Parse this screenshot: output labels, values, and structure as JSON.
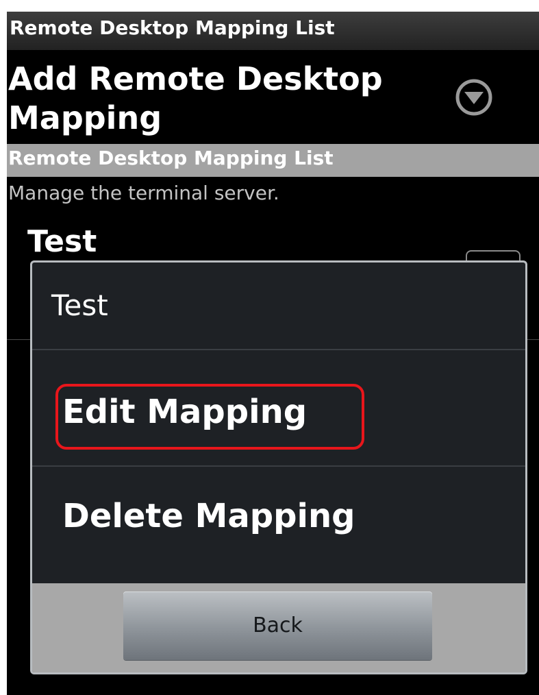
{
  "titlebar": {
    "title": "Remote Desktop Mapping List"
  },
  "add_mapping": {
    "title": "Add Remote Desktop Mapping",
    "icon": "dropdown-arrow-icon"
  },
  "section": {
    "header": "Remote Desktop Mapping List",
    "summary": "Manage the terminal server."
  },
  "list": {
    "items": [
      {
        "title": "Test"
      }
    ]
  },
  "dialog": {
    "title": "Test",
    "items": [
      {
        "label": "Edit Mapping",
        "highlighted": true
      },
      {
        "label": "Delete Mapping",
        "highlighted": false
      }
    ],
    "back_label": "Back"
  },
  "colors": {
    "background": "#000000",
    "section_header": "#a3a3a3",
    "dialog_background": "#1e2125",
    "dialog_border": "#b8bcc0",
    "highlight": "#e8161b",
    "button_bar": "#a8a8a8"
  }
}
